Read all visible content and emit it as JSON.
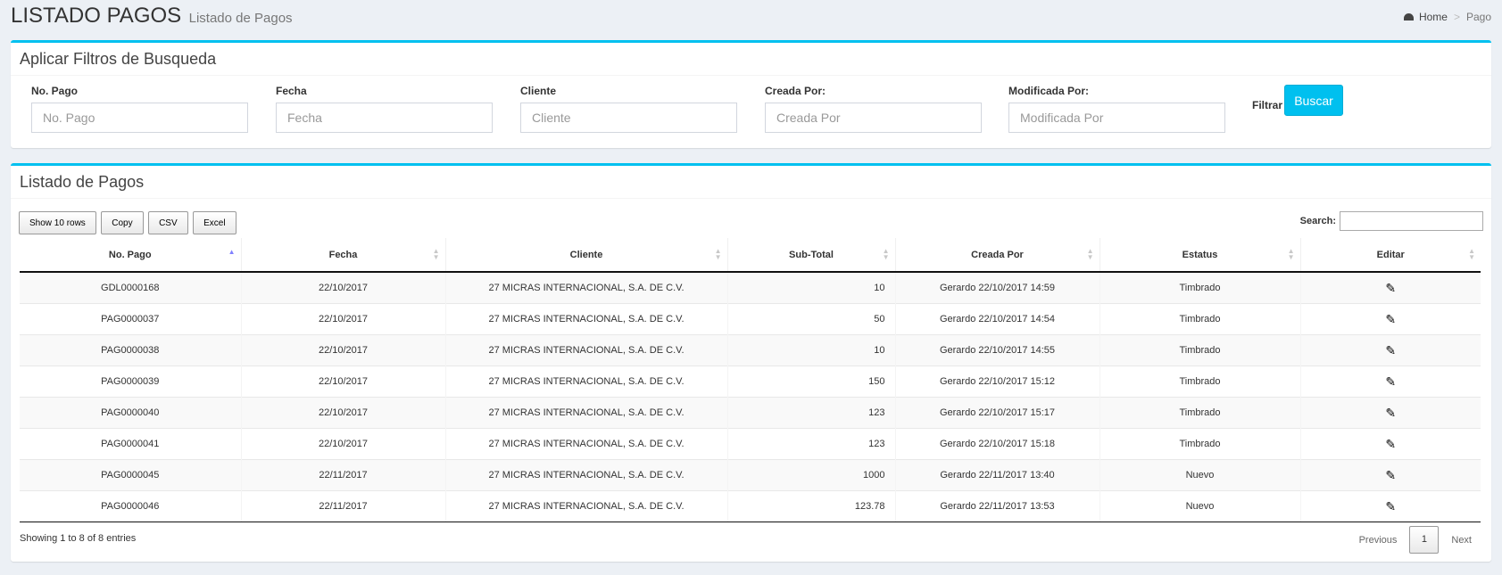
{
  "header": {
    "title": "LISTADO PAGOS",
    "subtitle": "Listado de Pagos",
    "breadcrumb": {
      "home": "Home",
      "separator": ">",
      "current": "Pago"
    }
  },
  "filters": {
    "title": "Aplicar Filtros de Busqueda",
    "fields": [
      {
        "label": "No. Pago",
        "placeholder": "No. Pago"
      },
      {
        "label": "Fecha",
        "placeholder": "Fecha"
      },
      {
        "label": "Cliente",
        "placeholder": "Cliente"
      },
      {
        "label": "Creada Por:",
        "placeholder": "Creada Por"
      },
      {
        "label": "Modificada Por:",
        "placeholder": "Modificada Por"
      }
    ],
    "filtrar_label": "Filtrar",
    "buscar_label": "Buscar"
  },
  "list": {
    "title": "Listado de Pagos",
    "buttons": {
      "show": "Show 10 rows",
      "copy": "Copy",
      "csv": "CSV",
      "excel": "Excel"
    },
    "search_label": "Search:",
    "columns": [
      "No. Pago",
      "Fecha",
      "Cliente",
      "Sub-Total",
      "Creada Por",
      "Estatus",
      "Editar"
    ],
    "rows": [
      {
        "no": "GDL0000168",
        "fecha": "22/10/2017",
        "cliente": "27 MICRAS INTERNACIONAL, S.A. DE C.V.",
        "subtotal": "10",
        "creada": "Gerardo 22/10/2017 14:59",
        "estatus": "Timbrado"
      },
      {
        "no": "PAG0000037",
        "fecha": "22/10/2017",
        "cliente": "27 MICRAS INTERNACIONAL, S.A. DE C.V.",
        "subtotal": "50",
        "creada": "Gerardo 22/10/2017 14:54",
        "estatus": "Timbrado"
      },
      {
        "no": "PAG0000038",
        "fecha": "22/10/2017",
        "cliente": "27 MICRAS INTERNACIONAL, S.A. DE C.V.",
        "subtotal": "10",
        "creada": "Gerardo 22/10/2017 14:55",
        "estatus": "Timbrado"
      },
      {
        "no": "PAG0000039",
        "fecha": "22/10/2017",
        "cliente": "27 MICRAS INTERNACIONAL, S.A. DE C.V.",
        "subtotal": "150",
        "creada": "Gerardo 22/10/2017 15:12",
        "estatus": "Timbrado"
      },
      {
        "no": "PAG0000040",
        "fecha": "22/10/2017",
        "cliente": "27 MICRAS INTERNACIONAL, S.A. DE C.V.",
        "subtotal": "123",
        "creada": "Gerardo 22/10/2017 15:17",
        "estatus": "Timbrado"
      },
      {
        "no": "PAG0000041",
        "fecha": "22/10/2017",
        "cliente": "27 MICRAS INTERNACIONAL, S.A. DE C.V.",
        "subtotal": "123",
        "creada": "Gerardo 22/10/2017 15:18",
        "estatus": "Timbrado"
      },
      {
        "no": "PAG0000045",
        "fecha": "22/11/2017",
        "cliente": "27 MICRAS INTERNACIONAL, S.A. DE C.V.",
        "subtotal": "1000",
        "creada": "Gerardo 22/11/2017 13:40",
        "estatus": "Nuevo"
      },
      {
        "no": "PAG0000046",
        "fecha": "22/11/2017",
        "cliente": "27 MICRAS INTERNACIONAL, S.A. DE C.V.",
        "subtotal": "123.78",
        "creada": "Gerardo 22/11/2017 13:53",
        "estatus": "Nuevo"
      }
    ],
    "edit_icon": "pencil-icon",
    "info": "Showing 1 to 8 of 8 entries",
    "pagination": {
      "previous": "Previous",
      "current_page": "1",
      "next": "Next"
    }
  },
  "colors": {
    "accent": "#00c0ef",
    "background": "#ecf0f5"
  }
}
